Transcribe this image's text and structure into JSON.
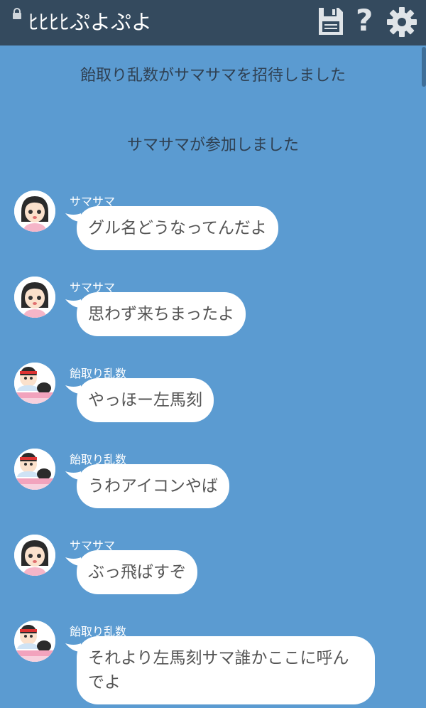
{
  "header": {
    "title": "ﾋﾋﾋﾋぷよぷよ",
    "lock_icon": "lock-icon",
    "save_icon": "save-icon",
    "help_label": "?",
    "settings_icon": "gear-icon"
  },
  "system_messages": [
    "飴取り乱数がサマサマを招待しました",
    "サマサマが参加しました"
  ],
  "messages": [
    {
      "sender": "サマサマ",
      "text": "グル名どうなってんだよ"
    },
    {
      "sender": "サマサマ",
      "text": "思わず来ちまったよ"
    },
    {
      "sender": "飴取り乱数",
      "text": "やっほー左馬刻"
    },
    {
      "sender": "飴取り乱数",
      "text": "うわアイコンやば"
    },
    {
      "sender": "サマサマ",
      "text": "ぶっ飛ばすぞ"
    },
    {
      "sender": "飴取り乱数",
      "text": "それより左馬刻サマ誰かここに呼ん",
      "text2": "でよ"
    }
  ],
  "colors": {
    "background": "#5b9bd1",
    "header": "#344a5e",
    "bubble": "#ffffff"
  }
}
